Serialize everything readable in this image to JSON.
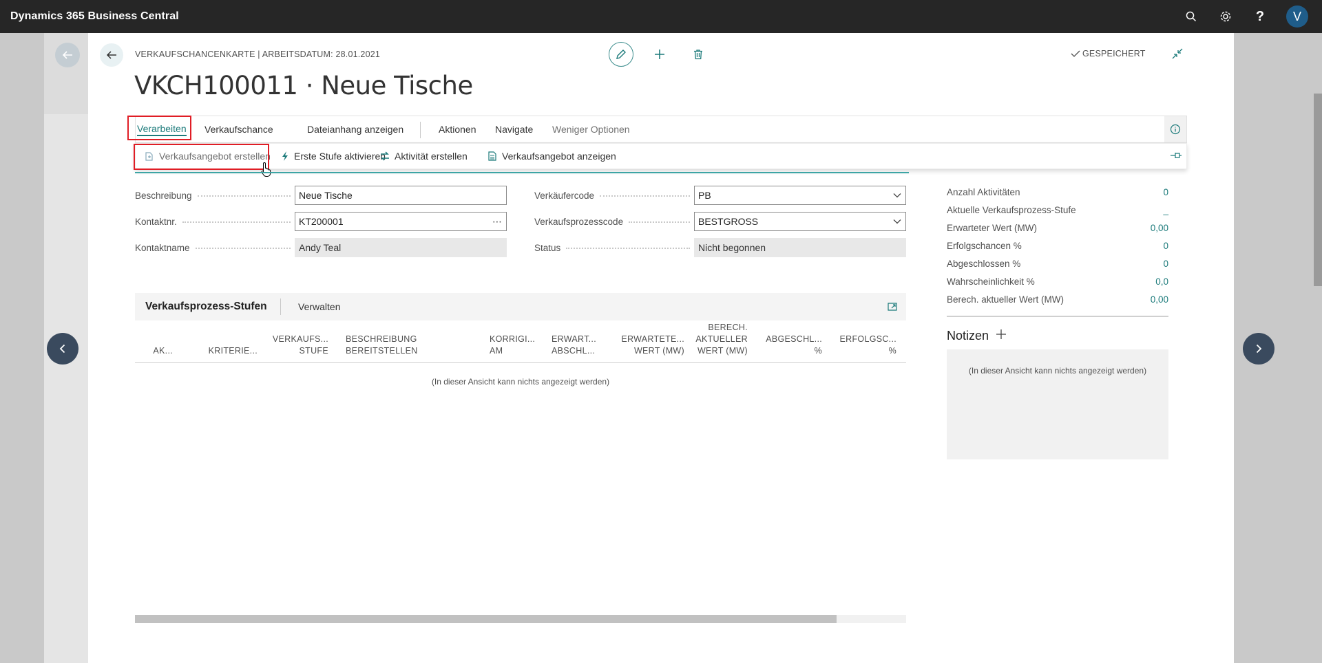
{
  "appbar": {
    "brand": "Dynamics 365 Business Central",
    "avatar_initial": "V",
    "help_label": "?"
  },
  "header": {
    "caption": "VERKAUFSCHANCENKARTE | ARBEITSDATUM: 28.01.2021",
    "title": "VKCH100011 · Neue Tische",
    "saved_status": "GESPEICHERT"
  },
  "actionbar": {
    "tabs": [
      "Verarbeiten",
      "Verkaufschance",
      "Dateianhang anzeigen",
      "Aktionen",
      "Navigate",
      "Weniger Optionen"
    ],
    "active_tab": "Verarbeiten"
  },
  "subactions": [
    {
      "label": "Verkaufsangebot erstellen",
      "icon": "create-quote-icon"
    },
    {
      "label": "Erste Stufe aktivieren",
      "icon": "lightning-icon"
    },
    {
      "label": "Aktivität erstellen",
      "icon": "activity-icon"
    },
    {
      "label": "Verkaufsangebot anzeigen",
      "icon": "document-icon"
    }
  ],
  "form": {
    "beschreibung": {
      "label": "Beschreibung",
      "value": "Neue Tische"
    },
    "kontaktnr": {
      "label": "Kontaktnr.",
      "value": "KT200001"
    },
    "kontaktname": {
      "label": "Kontaktname",
      "value": "Andy Teal"
    },
    "verkaeufercode": {
      "label": "Verkäufercode",
      "value": "PB"
    },
    "verkaufsprozesscode": {
      "label": "Verkaufsprozesscode",
      "value": "BESTGROSS"
    },
    "status": {
      "label": "Status",
      "value": "Nicht begonnen"
    }
  },
  "factbox": {
    "rows": [
      {
        "label": "Anzahl Aktivitäten",
        "value": "0"
      },
      {
        "label": "Aktuelle Verkaufsprozess-Stufe",
        "value": "_"
      },
      {
        "label": "Erwarteter Wert (MW)",
        "value": "0,00"
      },
      {
        "label": "Erfolgschancen %",
        "value": "0"
      },
      {
        "label": "Abgeschlossen %",
        "value": "0"
      },
      {
        "label": "Wahrscheinlichkeit %",
        "value": "0,0"
      },
      {
        "label": "Berech. aktueller Wert (MW)",
        "value": "0,00"
      }
    ],
    "notes_title": "Notizen",
    "notes_empty": "(In dieser Ansicht kann nichts angezeigt werden)"
  },
  "lines": {
    "title": "Verkaufsprozess-Stufen",
    "manage": "Verwalten",
    "columns": [
      [
        "AK..."
      ],
      [
        "KRITERIE..."
      ],
      [
        "VERKAUFS...",
        "STUFE"
      ],
      [
        "BESCHREIBUNG",
        "BEREITSTELLEN"
      ],
      [
        "KORRIGI...",
        "AM"
      ],
      [
        "ERWART...",
        "ABSCHL..."
      ],
      [
        "ERWARTETE...",
        "WERT (MW)"
      ],
      [
        "BERECH.",
        "AKTUELLER",
        "WERT (MW)"
      ],
      [
        "ABGESCHL...",
        "%"
      ],
      [
        "ERFOLGSC...",
        "%"
      ]
    ],
    "empty": "(In dieser Ansicht kann nichts angezeigt werden)",
    "scroll_fraction": 0.91
  },
  "colors": {
    "accent": "#1b7a7a",
    "appbar": "#262626",
    "highlight": "#e01d25"
  }
}
